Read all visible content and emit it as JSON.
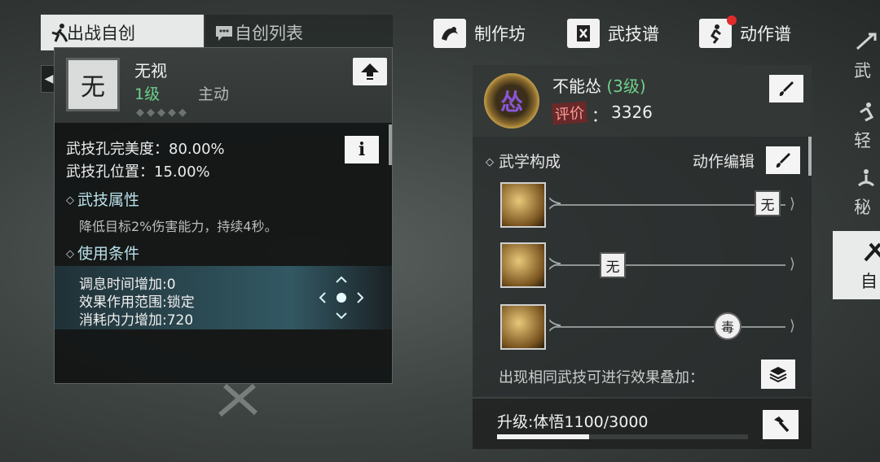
{
  "top_tabs": [
    {
      "label": "出战自创",
      "icon": "martial-pose-icon",
      "active": true
    },
    {
      "label": "自创列表",
      "icon": "chat-bubble-icon",
      "active": false
    }
  ],
  "top_buttons": [
    {
      "label": "制作坊",
      "icon": "workshop-icon"
    },
    {
      "label": "武技谱",
      "icon": "scroll-icon"
    },
    {
      "label": "动作谱",
      "icon": "action-icon",
      "badge": true
    }
  ],
  "side_tabs": [
    "武",
    "轻",
    "秘",
    "自"
  ],
  "popup": {
    "icon_char": "无",
    "name": "无视",
    "level": "1级",
    "type": "主动",
    "stars": "◆◆◆◆◆",
    "perfection": "武技孔完美度：80.00%",
    "position": "武技孔位置：15.00%",
    "attr_title": "武技属性",
    "attr_desc": "降低目标2%伤害能力，持续4秒。",
    "cond_title": "使用条件",
    "cond_lines": [
      "调息时间增加:0",
      "效果作用范围:锁定",
      "消耗内力增加:720"
    ]
  },
  "combo": {
    "medal_char": "怂",
    "name": "不能怂",
    "level": "(3级)",
    "rating_label": "评价",
    "rating_sep": "：",
    "rating": "3326",
    "section_title": "武学构成",
    "edit_label": "动作编辑",
    "lanes": [
      {
        "marker": "无",
        "marker_shape": "square",
        "position_pct": 100
      },
      {
        "marker": "无",
        "marker_shape": "square",
        "position_pct": 25
      },
      {
        "marker": "毒",
        "marker_shape": "round",
        "position_pct": 80
      }
    ],
    "stack_text": "出现相同武技可进行效果叠加："
  },
  "upgrade": {
    "text": "升级:体悟1100/3000",
    "progress": 0.367
  },
  "colors": {
    "level_green": "#6fcf8a",
    "section_cyan": "#b9e1e9",
    "badge_red": "#e02b2b"
  }
}
